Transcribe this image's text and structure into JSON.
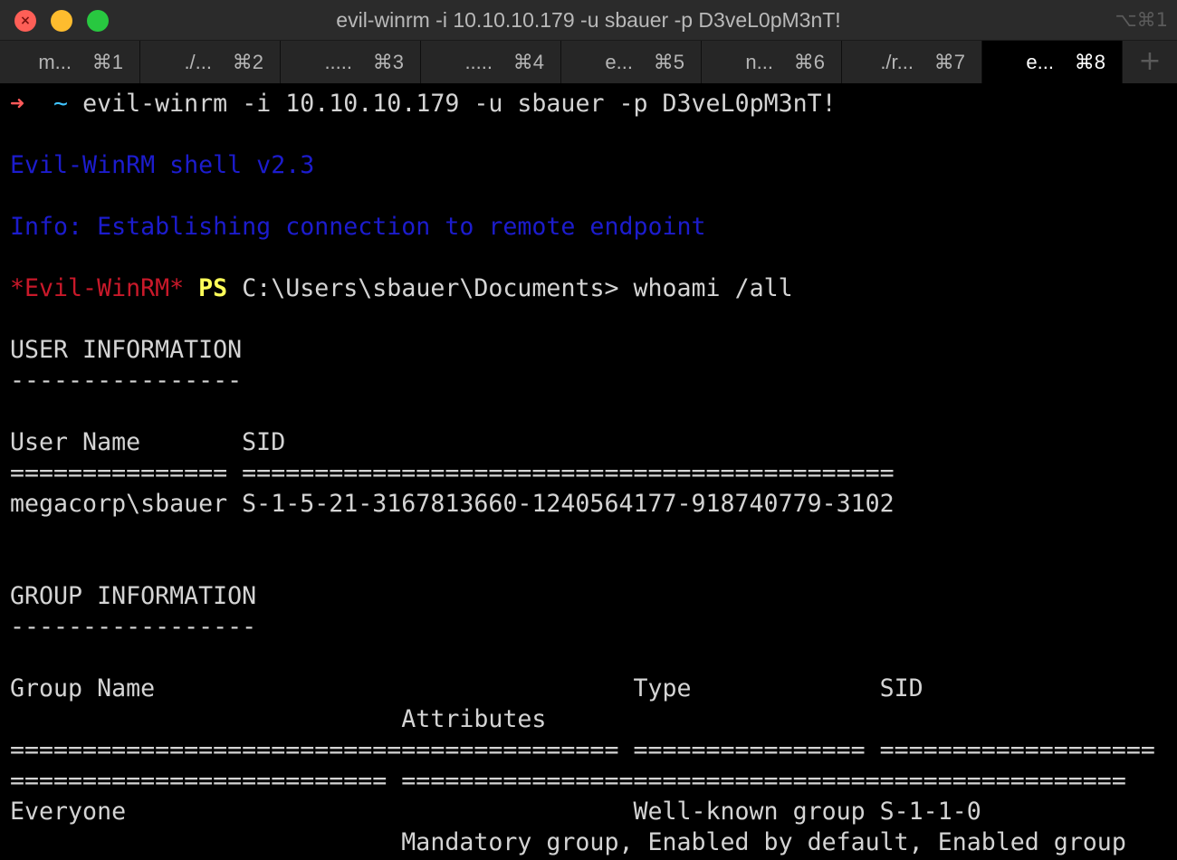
{
  "window": {
    "title": "evil-winrm -i 10.10.10.179 -u sbauer -p D3veL0pM3nT!",
    "title_shortcut": "⌥⌘1"
  },
  "tabs": [
    {
      "label": "m...",
      "shortcut": "⌘1",
      "active": false
    },
    {
      "label": "./...",
      "shortcut": "⌘2",
      "active": false
    },
    {
      "label": ".....",
      "shortcut": "⌘3",
      "active": false
    },
    {
      "label": ".....",
      "shortcut": "⌘4",
      "active": false
    },
    {
      "label": "e...",
      "shortcut": "⌘5",
      "active": false
    },
    {
      "label": "n...",
      "shortcut": "⌘6",
      "active": false
    },
    {
      "label": "./r...",
      "shortcut": "⌘7",
      "active": false
    },
    {
      "label": "e...",
      "shortcut": "⌘8",
      "active": true
    }
  ],
  "new_tab_icon": "plus-icon",
  "colors": {
    "arrow": "#fe5a5a",
    "tilde": "#40c4ff",
    "evil_winrm_banner": "#1c1ccd",
    "prompt_tag": "#c9192a",
    "ps": "#ffff59",
    "text": "#d4d4d4"
  },
  "terminal": {
    "command_arrow": "➜",
    "command_dir": "~",
    "command": "evil-winrm -i 10.10.10.179 -u sbauer -p D3veL0pM3nT!",
    "banner": "Evil-WinRM shell v2.3",
    "info": "Info: Establishing connection to remote endpoint",
    "prompt_tag": "*Evil-WinRM*",
    "prompt_ps": "PS",
    "prompt_path": "C:\\Users\\sbauer\\Documents>",
    "prompt_cmd": "whoami /all",
    "user_info_title": "USER INFORMATION",
    "user_info_underline": "----------------",
    "user_table_header": "User Name       SID",
    "user_table_rule": "=============== =============================================",
    "user_table_row": "megacorp\\sbauer S-1-5-21-3167813660-1240564177-918740779-3102",
    "group_info_title": "GROUP INFORMATION",
    "group_info_underline": "-----------------",
    "group_header_1": "Group Name                                 Type             SID",
    "group_header_2": "                           Attributes",
    "group_rule_1": "========================================== ================ ===================",
    "group_rule_2": "========================== ==================================================",
    "group_row_1": "Everyone                                   Well-known group S-1-1-0",
    "group_row_2": "                           Mandatory group, Enabled by default, Enabled group"
  }
}
